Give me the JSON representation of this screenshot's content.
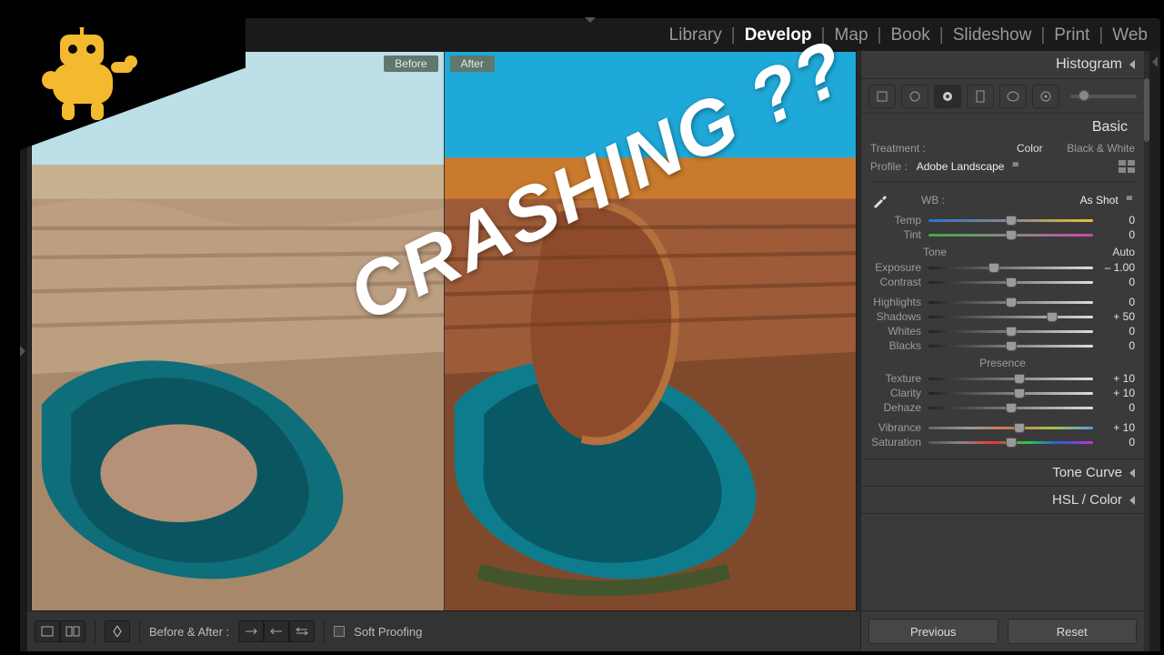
{
  "modules": {
    "library": "Library",
    "develop": "Develop",
    "map": "Map",
    "book": "Book",
    "slideshow": "Slideshow",
    "print": "Print",
    "web": "Web"
  },
  "compare": {
    "before": "Before",
    "after": "After"
  },
  "toolbar": {
    "before_after_label": "Before & After :",
    "soft_proof": "Soft Proofing"
  },
  "panels": {
    "histogram": "Histogram",
    "basic": "Basic",
    "tone_curve": "Tone Curve",
    "hsl_color": "HSL / Color"
  },
  "basic": {
    "treatment_label": "Treatment :",
    "color": "Color",
    "bw": "Black & White",
    "profile_label": "Profile :",
    "profile_value": "Adobe Landscape",
    "wb_label": "WB :",
    "wb_value": "As Shot",
    "tone_label": "Tone",
    "auto": "Auto",
    "presence_label": "Presence",
    "sliders": {
      "temp": {
        "label": "Temp",
        "value": "0",
        "pos": 50
      },
      "tint": {
        "label": "Tint",
        "value": "0",
        "pos": 50
      },
      "exposure": {
        "label": "Exposure",
        "value": "– 1.00",
        "pos": 40
      },
      "contrast": {
        "label": "Contrast",
        "value": "0",
        "pos": 50
      },
      "highlights": {
        "label": "Highlights",
        "value": "0",
        "pos": 50
      },
      "shadows": {
        "label": "Shadows",
        "value": "+ 50",
        "pos": 75
      },
      "whites": {
        "label": "Whites",
        "value": "0",
        "pos": 50
      },
      "blacks": {
        "label": "Blacks",
        "value": "0",
        "pos": 50
      },
      "texture": {
        "label": "Texture",
        "value": "+ 10",
        "pos": 55
      },
      "clarity": {
        "label": "Clarity",
        "value": "+ 10",
        "pos": 55
      },
      "dehaze": {
        "label": "Dehaze",
        "value": "0",
        "pos": 50
      },
      "vibrance": {
        "label": "Vibrance",
        "value": "+ 10",
        "pos": 55
      },
      "saturation": {
        "label": "Saturation",
        "value": "0",
        "pos": 50
      }
    }
  },
  "buttons": {
    "previous": "Previous",
    "reset": "Reset"
  },
  "overlay": {
    "crashing": "CRASHING ??"
  }
}
